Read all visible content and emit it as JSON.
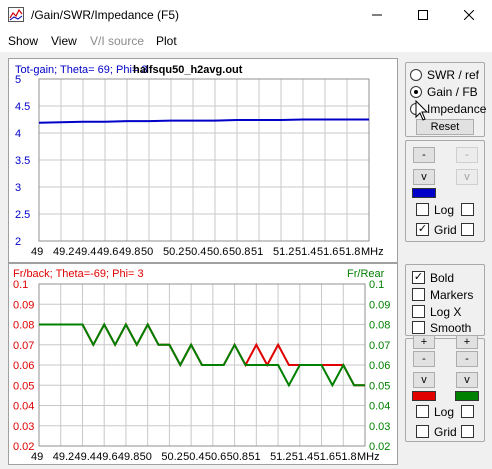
{
  "window": {
    "title": "/Gain/SWR/Impedance (F5)",
    "controls": {
      "minimize": "—",
      "maximize": "☐",
      "close": "✕"
    }
  },
  "menu": [
    "Show",
    "View",
    "V/I source",
    "Plot"
  ],
  "colors": {
    "blue": "#0000c8",
    "red": "#e00000",
    "green": "#008000",
    "grid": "#c8c8c8"
  },
  "top_chart": {
    "header": "Tot-gain; Theta= 69; Phi= 3",
    "file": "halfsqu50_h2avg.out",
    "yticks": [
      "5",
      "4.5",
      "4",
      "3.5",
      "3",
      "2.5",
      "2"
    ],
    "xticks": [
      "49",
      "49.2",
      "49.4",
      "49.6",
      "49.8",
      "50",
      "50.2",
      "50.4",
      "50.6",
      "50.8",
      "51",
      "51.2",
      "51.4",
      "51.6",
      "51.8"
    ],
    "xunit": "MHz"
  },
  "bottom_chart": {
    "header_left": "Fr/back; Theta=-69; Phi= 3",
    "header_right": "Fr/Rear",
    "yticks": [
      "0.1",
      "0.09",
      "0.08",
      "0.07",
      "0.06",
      "0.05",
      "0.04",
      "0.03",
      "0.02"
    ],
    "xticks": [
      "49",
      "49.2",
      "49.4",
      "49.6",
      "49.8",
      "50",
      "50.2",
      "50.4",
      "50.6",
      "50.8",
      "51",
      "51.2",
      "51.4",
      "51.6",
      "51.8"
    ],
    "xunit": "MHz"
  },
  "chart_data": [
    {
      "type": "line",
      "title": "Tot-gain; Theta= 69; Phi= 3",
      "xlabel": "MHz",
      "ylim": [
        2,
        5
      ],
      "x": [
        49,
        49.2,
        49.4,
        49.6,
        49.8,
        50,
        50.2,
        50.4,
        50.6,
        50.8,
        51,
        51.2,
        51.4,
        51.6,
        51.8,
        52
      ],
      "series": [
        {
          "name": "Tot-gain",
          "color": "#0000c8",
          "values": [
            4.19,
            4.2,
            4.21,
            4.21,
            4.22,
            4.22,
            4.23,
            4.23,
            4.23,
            4.24,
            4.24,
            4.24,
            4.25,
            4.25,
            4.25,
            4.25
          ]
        }
      ]
    },
    {
      "type": "line",
      "title": "Fr/back; Theta=-69; Phi= 3",
      "xlabel": "MHz",
      "ylim": [
        0.02,
        0.1
      ],
      "x": [
        49,
        49.2,
        49.4,
        49.5,
        49.6,
        49.7,
        49.8,
        49.9,
        50,
        50.1,
        50.2,
        50.3,
        50.4,
        50.5,
        50.6,
        50.7,
        50.8,
        50.9,
        51,
        51.1,
        51.2,
        51.3,
        51.4,
        51.5,
        51.6,
        51.7,
        51.8,
        51.9,
        52
      ],
      "series": [
        {
          "name": "Fr/back",
          "color": "#e00000",
          "values": [
            0.08,
            0.08,
            0.08,
            0.07,
            0.08,
            0.07,
            0.08,
            0.07,
            0.08,
            0.07,
            0.07,
            0.06,
            0.07,
            0.06,
            0.06,
            0.06,
            0.07,
            0.06,
            0.07,
            0.06,
            0.07,
            0.06,
            0.06,
            0.06,
            0.06,
            0.06,
            0.06,
            0.05,
            0.05
          ]
        },
        {
          "name": "Fr/Rear",
          "color": "#008000",
          "values": [
            0.08,
            0.08,
            0.08,
            0.07,
            0.08,
            0.07,
            0.08,
            0.07,
            0.08,
            0.07,
            0.07,
            0.06,
            0.07,
            0.06,
            0.06,
            0.06,
            0.07,
            0.06,
            0.06,
            0.06,
            0.06,
            0.05,
            0.06,
            0.06,
            0.06,
            0.05,
            0.06,
            0.05,
            0.05
          ]
        }
      ]
    }
  ],
  "panel_top": {
    "radios": [
      {
        "label": "SWR / ref",
        "checked": false
      },
      {
        "label": "Gain / FB",
        "checked": true
      },
      {
        "label": "Impedance",
        "checked": false
      }
    ],
    "reset": "Reset"
  },
  "controls_top": {
    "btn_up": "-",
    "btn_dn": "v",
    "log": "Log",
    "grid": "Grid",
    "log_checked": false,
    "grid_checked": true
  },
  "panel_mid": {
    "items": [
      {
        "label": "Bold",
        "checked": true
      },
      {
        "label": "Markers",
        "checked": false
      },
      {
        "label": "Log X",
        "checked": false
      },
      {
        "label": "Smooth",
        "checked": false
      }
    ]
  },
  "controls_bottom": {
    "btn_plus": "+",
    "btn_minus": "-",
    "btn_dn": "v",
    "log": "Log",
    "grid": "Grid",
    "log_checked": false,
    "grid_checked": false
  }
}
